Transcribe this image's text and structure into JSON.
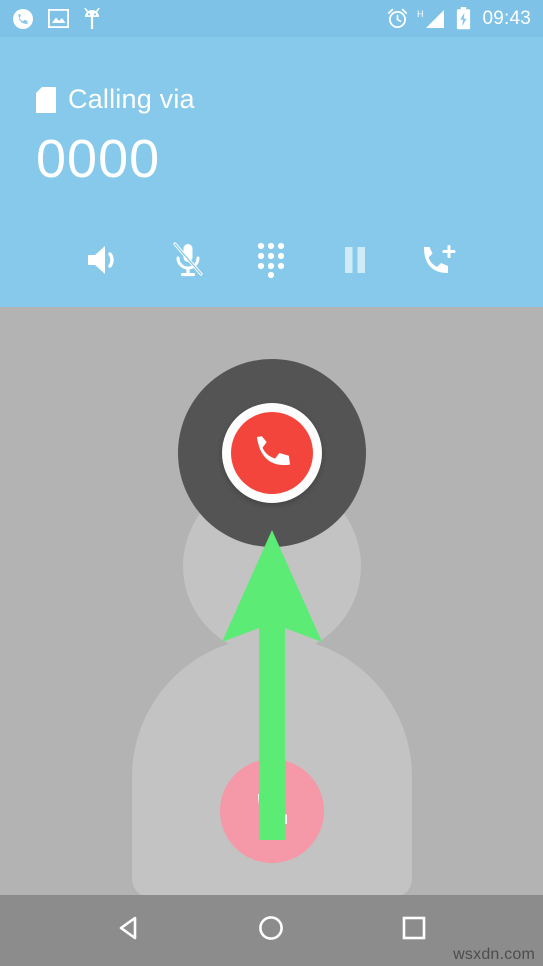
{
  "status_bar": {
    "left_icons": [
      {
        "name": "phone-call-icon",
        "label": "Ongoing call"
      },
      {
        "name": "image-icon",
        "label": "Screenshot captured"
      },
      {
        "name": "android-debug-icon",
        "label": "USB debugging"
      }
    ],
    "right_icons": [
      {
        "name": "alarm-clock-icon",
        "label": "Alarm set"
      },
      {
        "name": "signal-h-icon",
        "label": "H"
      },
      {
        "name": "battery-charging-icon",
        "label": "Charging"
      }
    ],
    "network_type": "H",
    "clock": "09:43"
  },
  "header": {
    "sim_icon": "sim-card-icon",
    "via_label": "Calling via",
    "number": "0000",
    "background_color": "#87c9ea",
    "text_color": "#ffffff"
  },
  "controls": [
    {
      "name": "speaker-button",
      "icon": "speaker-icon",
      "label": "Speaker",
      "state": "off"
    },
    {
      "name": "mute-button",
      "icon": "microphone-muted-icon",
      "label": "Mute",
      "state": "muted"
    },
    {
      "name": "dialpad-button",
      "icon": "dialpad-icon",
      "label": "Dialpad",
      "state": "off"
    },
    {
      "name": "hold-button",
      "icon": "pause-icon",
      "label": "Hold",
      "state": "disabled"
    },
    {
      "name": "add-call-button",
      "icon": "add-call-icon",
      "label": "Add call",
      "state": "off"
    }
  ],
  "call_actions": {
    "end_call": {
      "name": "end-call-button",
      "icon": "phone-hangup-icon",
      "label": "End call",
      "color": "#f4453c",
      "halo_color": "#545454"
    },
    "answer": {
      "name": "answer-call-button",
      "icon": "phone-handset-icon",
      "label": "Answer",
      "color": "#f598a8"
    },
    "gesture_hint": {
      "name": "swipe-up-arrow",
      "label": "Swipe up to end call",
      "color": "#5ceb74"
    }
  },
  "avatar": {
    "name": "contact-avatar-placeholder",
    "color": "#c3c3c3"
  },
  "nav_bar": {
    "background_color": "#8c8c8c",
    "buttons": [
      {
        "name": "nav-back-button",
        "icon": "back-triangle-icon",
        "label": "Back"
      },
      {
        "name": "nav-home-button",
        "icon": "home-circle-icon",
        "label": "Home"
      },
      {
        "name": "nav-recents-button",
        "icon": "recents-square-icon",
        "label": "Recents"
      }
    ]
  },
  "watermark": {
    "text": "wsxdn.com"
  },
  "screen": {
    "background_color": "#b3b3b3"
  }
}
